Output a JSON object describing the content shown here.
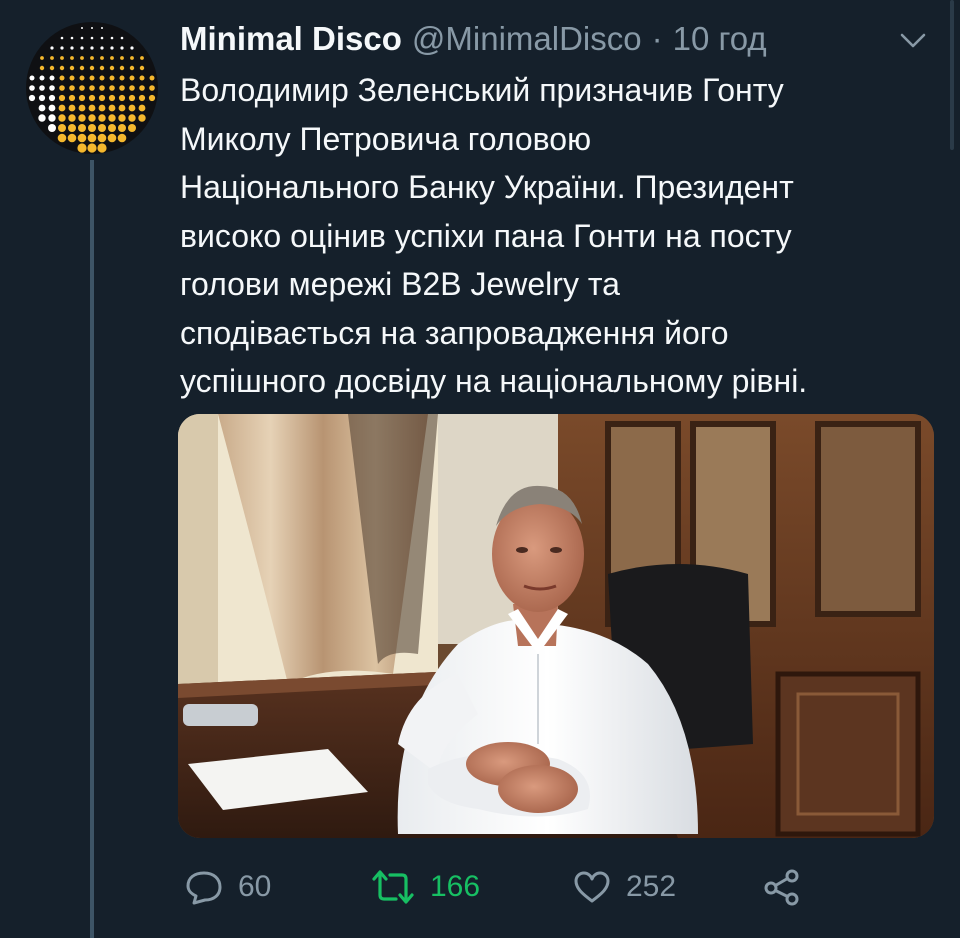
{
  "author": {
    "name": "Minimal Disco",
    "handle": "@MinimalDisco",
    "separator": "·",
    "time": "10 год"
  },
  "tweet": {
    "lines": [
      "Володимир Зеленський призначив Гонту",
      "Миколу Петровича головою",
      "Національного Банку України. Президент",
      "високо оцінив успіхи пана Гонти на посту",
      "голови мережі B2B Jewelry та",
      "сподівається на запровадження його",
      "успішного досвіду на національному рівні."
    ]
  },
  "actions": {
    "reply_count": "60",
    "retweet_count": "166",
    "like_count": "252"
  },
  "colors": {
    "background": "#15202b",
    "secondary_text": "#8899a6",
    "retweet_active": "#17bf63",
    "avatar_dots": "#f5b82e"
  },
  "icons": {
    "menu": "chevron-down-icon",
    "reply": "speech-bubble-icon",
    "retweet": "retweet-arrows-icon",
    "like": "heart-icon",
    "share": "share-nodes-icon"
  }
}
